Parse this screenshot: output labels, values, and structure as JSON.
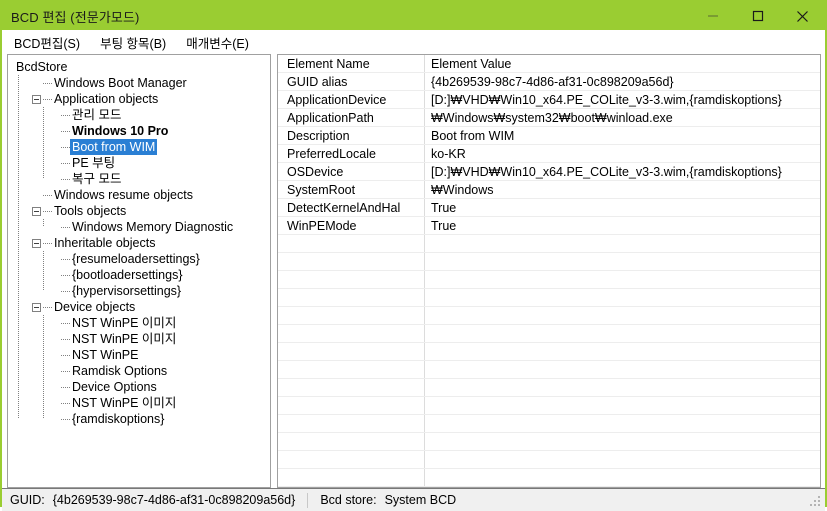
{
  "window": {
    "title": "BCD 편집 (전문가모드)",
    "accent_color": "#9acd32",
    "selection_color": "#2a7fd4",
    "controls": {
      "minimize": "minimize-icon",
      "maximize": "maximize-icon",
      "close": "close-icon"
    }
  },
  "menubar": {
    "items": [
      {
        "label": "BCD편집(S)"
      },
      {
        "label": "부팅 항목(B)"
      },
      {
        "label": "매개변수(E)"
      }
    ]
  },
  "tree": {
    "root_label": "BcdStore",
    "nodes": [
      {
        "label": "BcdStore",
        "depth": 0,
        "twisty": "none",
        "connector": false,
        "selected": false,
        "bold": false
      },
      {
        "label": "Windows Boot Manager",
        "depth": 1,
        "twisty": "none",
        "connector": true,
        "selected": false,
        "bold": false
      },
      {
        "label": "Application objects",
        "depth": 1,
        "twisty": "expanded",
        "connector": true,
        "selected": false,
        "bold": false
      },
      {
        "label": "관리 모드",
        "depth": 2,
        "twisty": "none",
        "connector": true,
        "selected": false,
        "bold": false
      },
      {
        "label": "Windows 10 Pro",
        "depth": 2,
        "twisty": "none",
        "connector": true,
        "selected": false,
        "bold": true
      },
      {
        "label": "Boot from WIM",
        "depth": 2,
        "twisty": "none",
        "connector": true,
        "selected": true,
        "bold": false
      },
      {
        "label": "PE 부팅",
        "depth": 2,
        "twisty": "none",
        "connector": true,
        "selected": false,
        "bold": false
      },
      {
        "label": "복구 모드",
        "depth": 2,
        "twisty": "none",
        "connector": true,
        "selected": false,
        "bold": false
      },
      {
        "label": "Windows resume objects",
        "depth": 1,
        "twisty": "none",
        "connector": true,
        "selected": false,
        "bold": false
      },
      {
        "label": "Tools objects",
        "depth": 1,
        "twisty": "expanded",
        "connector": true,
        "selected": false,
        "bold": false
      },
      {
        "label": "Windows Memory Diagnostic",
        "depth": 2,
        "twisty": "none",
        "connector": true,
        "selected": false,
        "bold": false
      },
      {
        "label": "Inheritable objects",
        "depth": 1,
        "twisty": "expanded",
        "connector": true,
        "selected": false,
        "bold": false
      },
      {
        "label": "{resumeloadersettings}",
        "depth": 2,
        "twisty": "none",
        "connector": true,
        "selected": false,
        "bold": false
      },
      {
        "label": "{bootloadersettings}",
        "depth": 2,
        "twisty": "none",
        "connector": true,
        "selected": false,
        "bold": false
      },
      {
        "label": "{hypervisorsettings}",
        "depth": 2,
        "twisty": "none",
        "connector": true,
        "selected": false,
        "bold": false
      },
      {
        "label": "Device objects",
        "depth": 1,
        "twisty": "expanded",
        "connector": true,
        "selected": false,
        "bold": false
      },
      {
        "label": "NST WinPE 이미지",
        "depth": 2,
        "twisty": "none",
        "connector": true,
        "selected": false,
        "bold": false
      },
      {
        "label": "NST WinPE 이미지",
        "depth": 2,
        "twisty": "none",
        "connector": true,
        "selected": false,
        "bold": false
      },
      {
        "label": "NST WinPE",
        "depth": 2,
        "twisty": "none",
        "connector": true,
        "selected": false,
        "bold": false
      },
      {
        "label": "Ramdisk Options",
        "depth": 2,
        "twisty": "none",
        "connector": true,
        "selected": false,
        "bold": false
      },
      {
        "label": "Device Options",
        "depth": 2,
        "twisty": "none",
        "connector": true,
        "selected": false,
        "bold": false
      },
      {
        "label": "NST WinPE 이미지",
        "depth": 2,
        "twisty": "none",
        "connector": true,
        "selected": false,
        "bold": false
      },
      {
        "label": "{ramdiskoptions}",
        "depth": 2,
        "twisty": "none",
        "connector": true,
        "selected": false,
        "bold": false
      }
    ]
  },
  "grid": {
    "columns": [
      "Element Name",
      "Element Value"
    ],
    "rows": [
      {
        "name": "GUID alias",
        "value": "{4b269539-98c7-4d86-af31-0c898209a56d}"
      },
      {
        "name": "ApplicationDevice",
        "value": "[D:]₩VHD₩Win10_x64.PE_COLite_v3-3.wim,{ramdiskoptions}"
      },
      {
        "name": "ApplicationPath",
        "value": "₩Windows₩system32₩boot₩winload.exe"
      },
      {
        "name": "Description",
        "value": "Boot from WIM"
      },
      {
        "name": "PreferredLocale",
        "value": "ko-KR"
      },
      {
        "name": "OSDevice",
        "value": "[D:]₩VHD₩Win10_x64.PE_COLite_v3-3.wim,{ramdiskoptions}"
      },
      {
        "name": "SystemRoot",
        "value": "₩Windows"
      },
      {
        "name": "DetectKernelAndHal",
        "value": "True"
      },
      {
        "name": "WinPEMode",
        "value": "True"
      }
    ],
    "empty_row_count": 14
  },
  "statusbar": {
    "guid_label": "GUID:",
    "guid_value": "{4b269539-98c7-4d86-af31-0c898209a56d}",
    "store_label": "Bcd store:",
    "store_value": "System BCD"
  }
}
